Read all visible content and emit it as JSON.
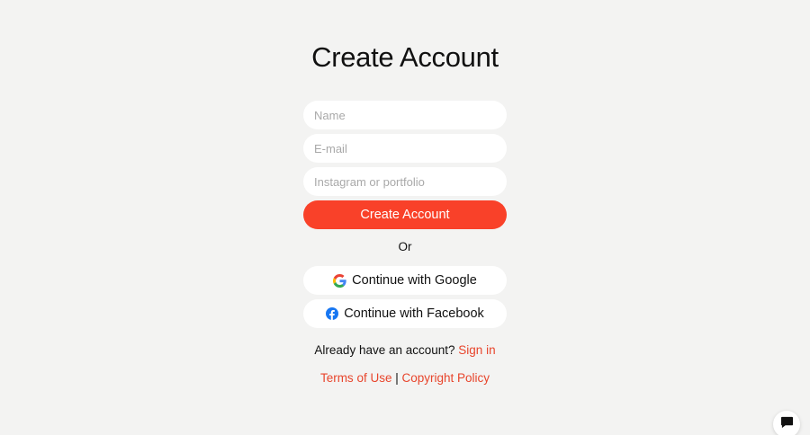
{
  "page": {
    "title": "Create Account"
  },
  "form": {
    "name_placeholder": "Name",
    "email_placeholder": "E-mail",
    "portfolio_placeholder": "Instagram or portfolio",
    "submit_label": "Create Account",
    "divider": "Or"
  },
  "social": {
    "google_label": "Continue with Google",
    "facebook_label": "Continue with Facebook",
    "google_icon": "google-g-icon",
    "facebook_icon": "facebook-f-icon"
  },
  "signin": {
    "prompt": "Already have an account?",
    "link": "Sign in"
  },
  "legal": {
    "terms": "Terms of Use",
    "separator": "|",
    "copyright": "Copyright Policy"
  },
  "chat": {
    "icon": "chat-bubble-icon"
  },
  "colors": {
    "background": "#f3f3f2",
    "accent": "#f94129",
    "link": "#e8452c",
    "facebook": "#1877f2"
  }
}
